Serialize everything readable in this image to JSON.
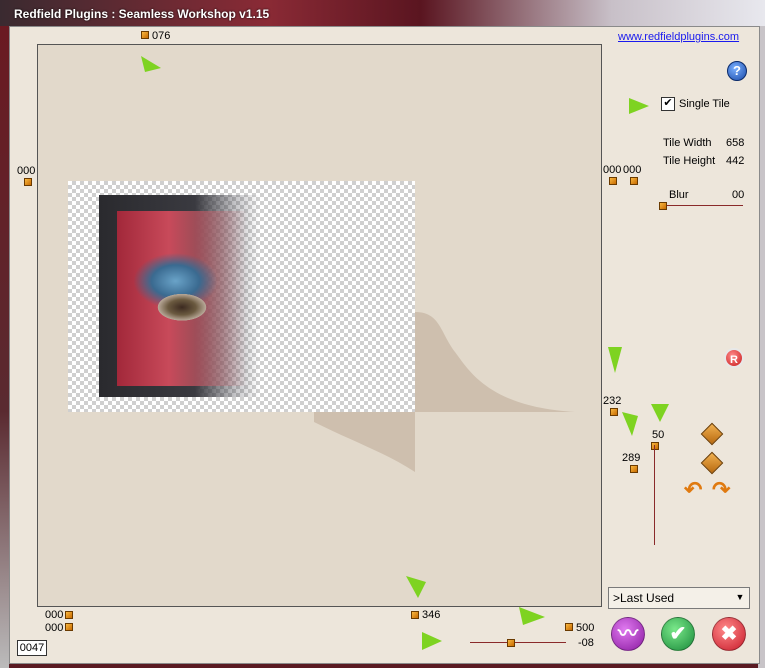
{
  "title": "Redfield Plugins : Seamless Workshop v1.15",
  "link": "www.redfieldplugins.com",
  "help_icon": "?",
  "single_tile": {
    "label": "Single Tile",
    "checked": true
  },
  "tile": {
    "width_label": "Tile Width",
    "width": "658",
    "height_label": "Tile Height",
    "height": "442"
  },
  "blur": {
    "label": "Blur",
    "value": "00"
  },
  "handles": {
    "top": "076",
    "left": "000",
    "right_a": "000",
    "right_b": "000",
    "v232": "232",
    "v50": "50",
    "v289": "289",
    "bottom_left_1": "000",
    "bottom_left_2": "000",
    "bottom_346": "346",
    "bottom_500": "500",
    "slider_value": "-08"
  },
  "reset_icon": "R",
  "preset": {
    "selected": ">Last Used"
  },
  "counter": "0047",
  "buttons": {
    "randomize": "randomize-icon",
    "ok": "ok-icon",
    "cancel": "cancel-icon"
  },
  "colors": {
    "accent_green": "#7ed321",
    "handle": "#e8900c",
    "ok": "#2ea84a",
    "cancel": "#d8283a",
    "randomize": "#b030c0"
  }
}
